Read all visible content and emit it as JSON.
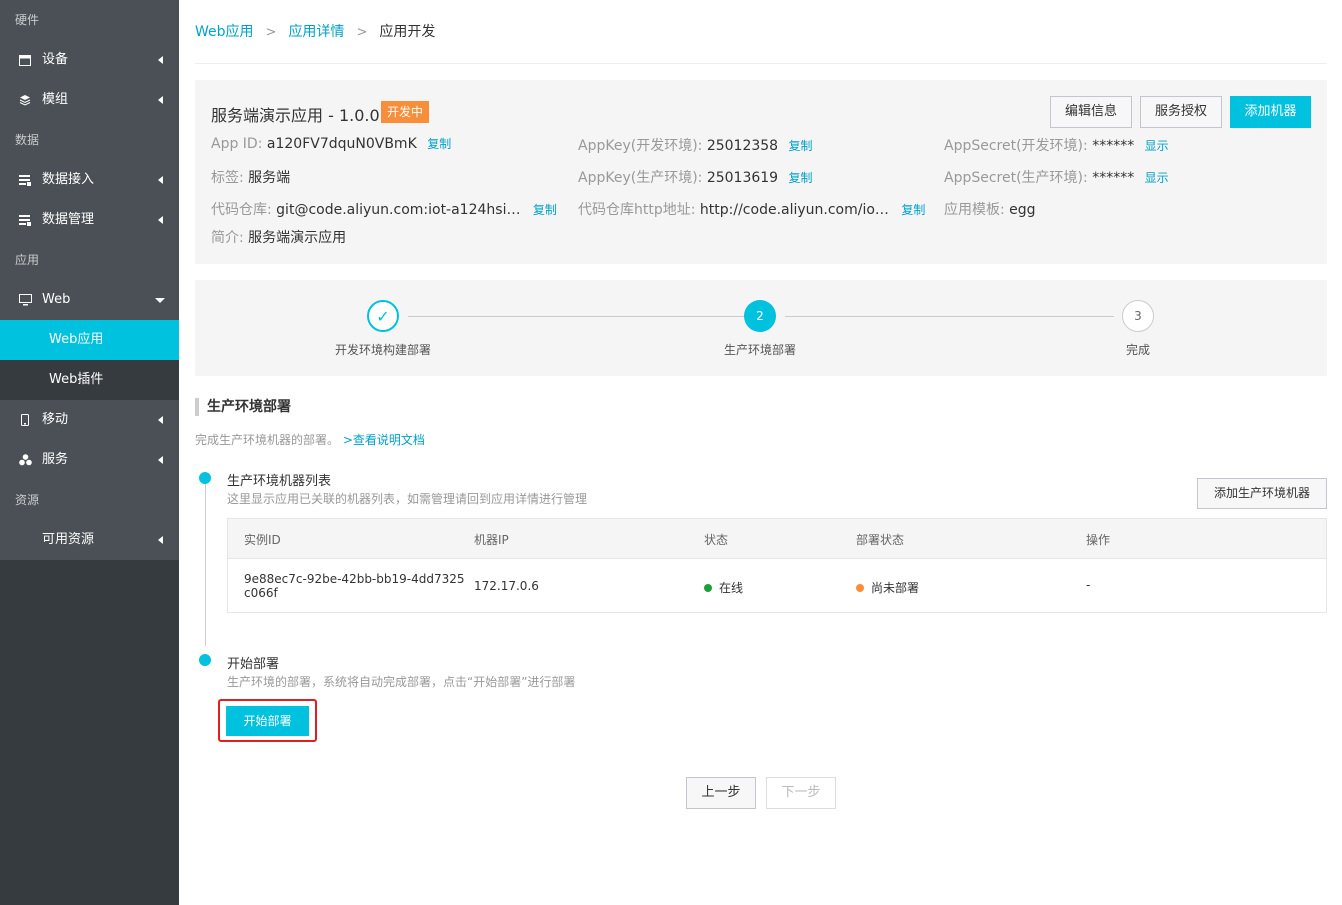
{
  "sidebar": {
    "sections": {
      "hardware": "硬件",
      "data": "数据",
      "app": "应用",
      "resource": "资源"
    },
    "items": {
      "device": "设备",
      "module": "模组",
      "data_access": "数据接入",
      "data_manage": "数据管理",
      "web": "Web",
      "web_app": "Web应用",
      "web_plugin": "Web插件",
      "mobile": "移动",
      "service": "服务",
      "available_resource": "可用资源"
    }
  },
  "breadcrumb": {
    "item1": "Web应用",
    "item2": "应用详情",
    "current": "应用开发",
    "sep": ">"
  },
  "app": {
    "title": "服务端演示应用 - 1.0.0",
    "status": "开发中",
    "buttons": {
      "edit": "编辑信息",
      "auth": "服务授权",
      "add_machine": "添加机器"
    },
    "fields": {
      "app_id_label": "App ID:",
      "app_id": "a120FV7dquN0VBmK",
      "copy": "复制",
      "show": "显示",
      "tag_label": "标签:",
      "tag": "服务端",
      "repo_label": "代码仓库:",
      "repo": "git@code.aliyun.com:iot-a124hsi…",
      "intro_label": "简介:",
      "intro": "服务端演示应用",
      "appkey_dev_label": "AppKey(开发环境):",
      "appkey_dev": "25012358",
      "appkey_prod_label": "AppKey(生产环境):",
      "appkey_prod": "25013619",
      "repo_http_label": "代码仓库http地址:",
      "repo_http": "http://code.aliyun.com/io…",
      "secret_dev_label": "AppSecret(开发环境):",
      "secret_dev": "******",
      "secret_prod_label": "AppSecret(生产环境):",
      "secret_prod": "******",
      "template_label": "应用模板:",
      "template": "egg"
    }
  },
  "steps": {
    "step1": {
      "label": "开发环境构建部署",
      "mark": "✓"
    },
    "step2": {
      "label": "生产环境部署",
      "mark": "2"
    },
    "step3": {
      "label": "完成",
      "mark": "3"
    }
  },
  "section": {
    "title": "生产环境部署",
    "desc": "完成生产环境机器的部署。",
    "doc_link": ">查看说明文档"
  },
  "machines": {
    "title": "生产环境机器列表",
    "desc": "这里显示应用已关联的机器列表，如需管理请回到应用详情进行管理",
    "add_button": "添加生产环境机器",
    "columns": {
      "instance": "实例ID",
      "ip": "机器IP",
      "status": "状态",
      "deploy_status": "部署状态",
      "action": "操作"
    },
    "rows": [
      {
        "instance_line1": "9e88ec7c-92be-42bb-bb19-4dd7325",
        "instance_line2": "c066f",
        "ip": "172.17.0.6",
        "status": "在线",
        "deploy_status": "尚未部署",
        "action": "-"
      }
    ]
  },
  "deploy": {
    "title": "开始部署",
    "desc": "生产环境的部署，系统将自动完成部署，点击“开始部署”进行部署",
    "button": "开始部署"
  },
  "pager": {
    "prev": "上一步",
    "next": "下一步"
  },
  "colors": {
    "accent": "#00c1de",
    "link": "#00a2ca",
    "sidebar_bg": "#363b3f",
    "tag_orange": "#f98e3a",
    "online_green": "#1e9f3a",
    "pending_orange": "#f98e3a",
    "highlight_red": "#e02020"
  }
}
